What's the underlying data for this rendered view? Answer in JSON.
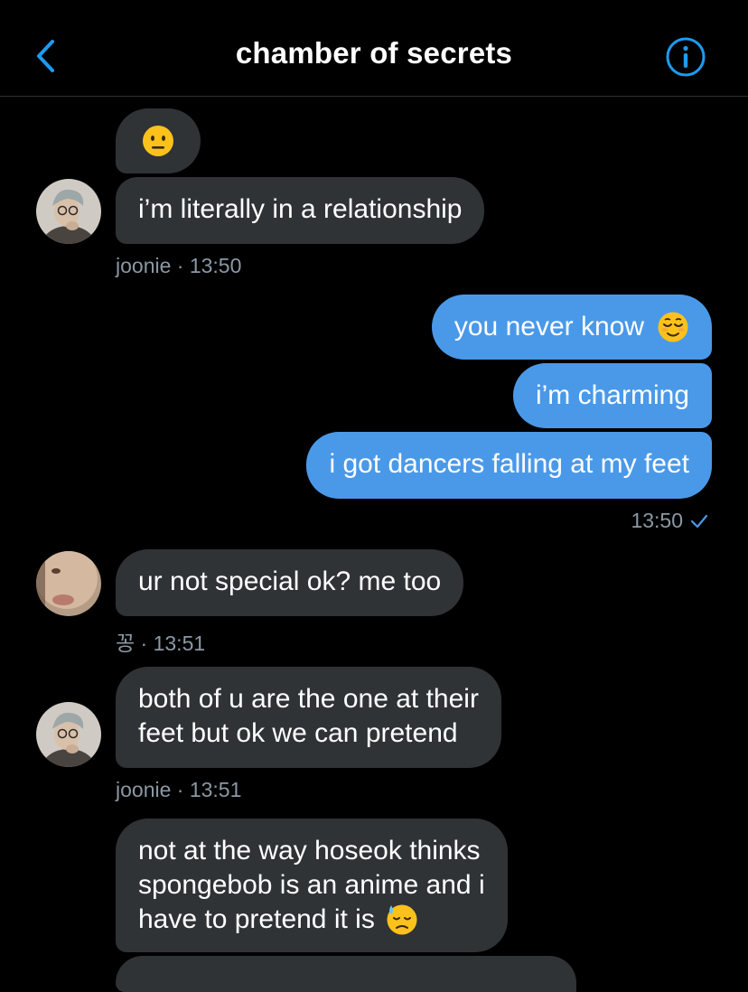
{
  "header": {
    "title": "chamber of secrets"
  },
  "messages": {
    "m1": {
      "text": "i’m literally in a relationship",
      "meta": "joonie · 13:50"
    },
    "m2": {
      "text": "you never know"
    },
    "m3": {
      "text": "i’m charming"
    },
    "m4": {
      "text": "i got dancers falling at my feet",
      "time": "13:50"
    },
    "m5": {
      "text": "ur not special ok? me too",
      "meta": "꽁 · 13:51"
    },
    "m6": {
      "line1": "both of u are the one at their",
      "line2": "feet but ok we can pretend",
      "meta": "joonie · 13:51"
    },
    "m7": {
      "line1": "not at the way hoseok thinks",
      "line2": "spongebob is an anime and i",
      "line3": "have to pretend it is"
    }
  },
  "colors": {
    "outgoing": "#4a99e9",
    "incoming": "#2f3336",
    "accent": "#1d9bf0"
  },
  "icons": [
    "back-chevron-icon",
    "info-icon",
    "neutral-face-emoji",
    "relieved-face-emoji",
    "sent-check-icon",
    "downcast-sweat-emoji"
  ]
}
